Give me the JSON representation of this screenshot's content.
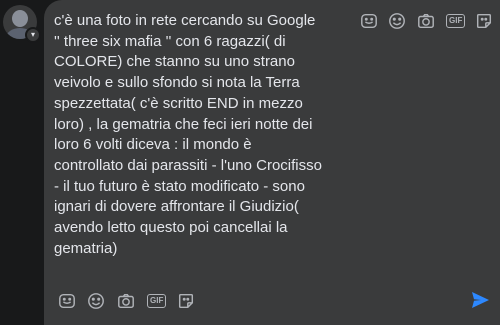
{
  "message": {
    "text": "c'è una foto in rete cercando su Google\n'' three six mafia '' con 6 ragazzi( di\nCOLORE) che stanno su uno strano\nveivolo e sullo sfondo si nota la Terra\nspezzettata( c'è scritto END in mezzo\nloro) , la gematria che feci ieri notte dei\nloro 6 volti diceva : il mondo è\ncontrollato dai parassiti - l'uno Crocifisso\n- il tuo futuro è stato modificato - sono\nignari di dovere affrontare il Giudizio(\navendo letto questo poi cancellai la\ngematria)"
  },
  "toolbar": {
    "gif_label": "GIF",
    "icons": [
      "sticker-icon",
      "emoji-icon",
      "camera-icon",
      "gif-icon",
      "sticker-alt-icon"
    ]
  },
  "colors": {
    "background": "#18191a",
    "bubble": "#3a3b3c",
    "text": "#e4e6eb",
    "icon": "#b0b3b8",
    "send": "#2d88ff"
  }
}
